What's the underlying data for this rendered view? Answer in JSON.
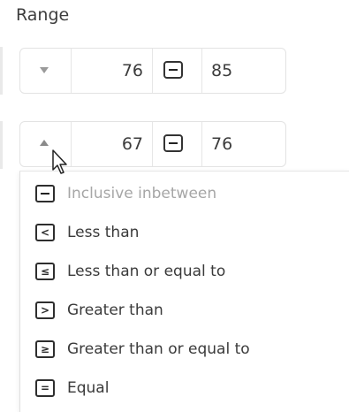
{
  "panel": {
    "title": "Range"
  },
  "rows": [
    {
      "direction": "down",
      "from": "76",
      "operator": "−",
      "to": "85"
    },
    {
      "direction": "up",
      "from": "67",
      "operator": "−",
      "to": "76"
    }
  ],
  "operator_menu": {
    "items": [
      {
        "icon": "minus-icon",
        "glyph": "−",
        "label": "Inclusive inbetween",
        "disabled": true
      },
      {
        "icon": "less-than-icon",
        "glyph": "<",
        "label": "Less than",
        "disabled": false
      },
      {
        "icon": "less-than-or-equal-icon",
        "glyph": "≤",
        "label": "Less than or equal to",
        "disabled": false
      },
      {
        "icon": "greater-than-icon",
        "glyph": ">",
        "label": "Greater than",
        "disabled": false
      },
      {
        "icon": "greater-than-or-equal-icon",
        "glyph": "≥",
        "label": "Greater than or equal to",
        "disabled": false
      },
      {
        "icon": "equal-icon",
        "glyph": "=",
        "label": "Equal",
        "disabled": false
      }
    ]
  }
}
